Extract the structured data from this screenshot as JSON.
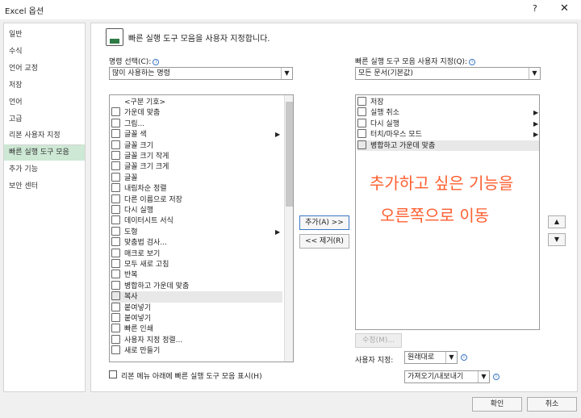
{
  "window": {
    "title": "Excel 옵션",
    "help": "?",
    "close": "✕"
  },
  "nav": [
    "일반",
    "수식",
    "언어 교정",
    "저장",
    "언어",
    "고급",
    "리본 사용자 지정",
    "빠른 실행 도구 모음",
    "추가 기능",
    "보안 센터"
  ],
  "selected_nav": "빠른 실행 도구 모음",
  "header": {
    "text": "빠른 실행 도구 모음을 사용자 지정합니다."
  },
  "commands": {
    "label": "명령 선택(C):",
    "selected": "많이 사용하는 명령",
    "items": [
      "<구분 기호>",
      "가운데 맞춤",
      "그림...",
      "글꼴 색",
      "글꼴 크기",
      "글꼴 크기 작게",
      "글꼴 크기 크게",
      "글꼴",
      "내림차순 정렬",
      "다른 이름으로 저장",
      "다시 실행",
      "데이터시트 서식",
      "도형",
      "맞춤법 검사...",
      "매크로 보기",
      "모두 새로 고침",
      "반복",
      "병합하고 가운데 맞춤",
      "복사",
      "붙여넣기",
      "붙여넣기",
      "빠른 인쇄",
      "사용자 지정 정렬...",
      "새로 만들기"
    ]
  },
  "qat": {
    "label": "빠른 실행 도구 모음 사용자 지정(Q):",
    "selected": "모든 문서(기본값)",
    "items": [
      "저장",
      "실행 취소",
      "다시 실행",
      "터치/마우스 모드",
      "병합하고 가운데 맞춤"
    ]
  },
  "buttons": {
    "add": "추가(A) >>",
    "remove": "<< 제거(R)",
    "modify": "수정(M)...",
    "ok": "확인",
    "cancel": "취소",
    "customize": "원래대로",
    "import_export": "가져오기/내보내기",
    "up": "▲",
    "down": "▼"
  },
  "customize_label": "사용자 지정:",
  "checkbox_label": "리본 메뉴 아래에 빠른 실행 도구 모음 표시(H)",
  "annotation": {
    "line1": "추가하고 싶은 기능을",
    "line2": "오른쪽으로 이동"
  }
}
